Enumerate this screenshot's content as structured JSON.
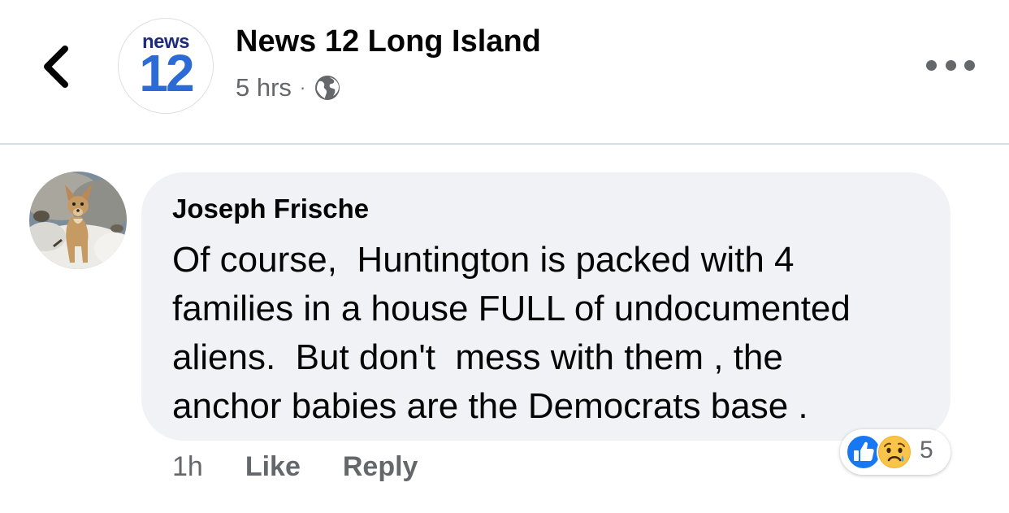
{
  "header": {
    "back_icon": "chevron-left-icon",
    "page_name": "News 12 Long Island",
    "avatar_logo": {
      "top_text": "news",
      "number_text": "12",
      "top_color": "#1d2b7a",
      "number_color": "#2c6bd6"
    },
    "post_time": "5 hrs",
    "separator": "·",
    "privacy_icon": "globe-icon",
    "more_icon": "more-horizontal-icon"
  },
  "comment": {
    "author": "Joseph Frische",
    "avatar_icon": "dog-photo-avatar",
    "text_lines": [
      "Of course,  Huntington is packed with 4",
      "families in a house FULL of undocumented",
      "aliens.  But don't  mess with them , the",
      "anchor babies are the Democrats base ."
    ],
    "time": "1h",
    "like_label": "Like",
    "reply_label": "Reply",
    "reactions": {
      "icons": [
        "like-reaction-icon",
        "sad-reaction-icon"
      ],
      "count": "5",
      "like_color": "#1877f2",
      "sad_color": "#f7b125"
    }
  },
  "colors": {
    "bubble": "#f0f2f5",
    "secondary_text": "#65676b",
    "primary_text": "#050505",
    "divider": "#dadde1"
  }
}
